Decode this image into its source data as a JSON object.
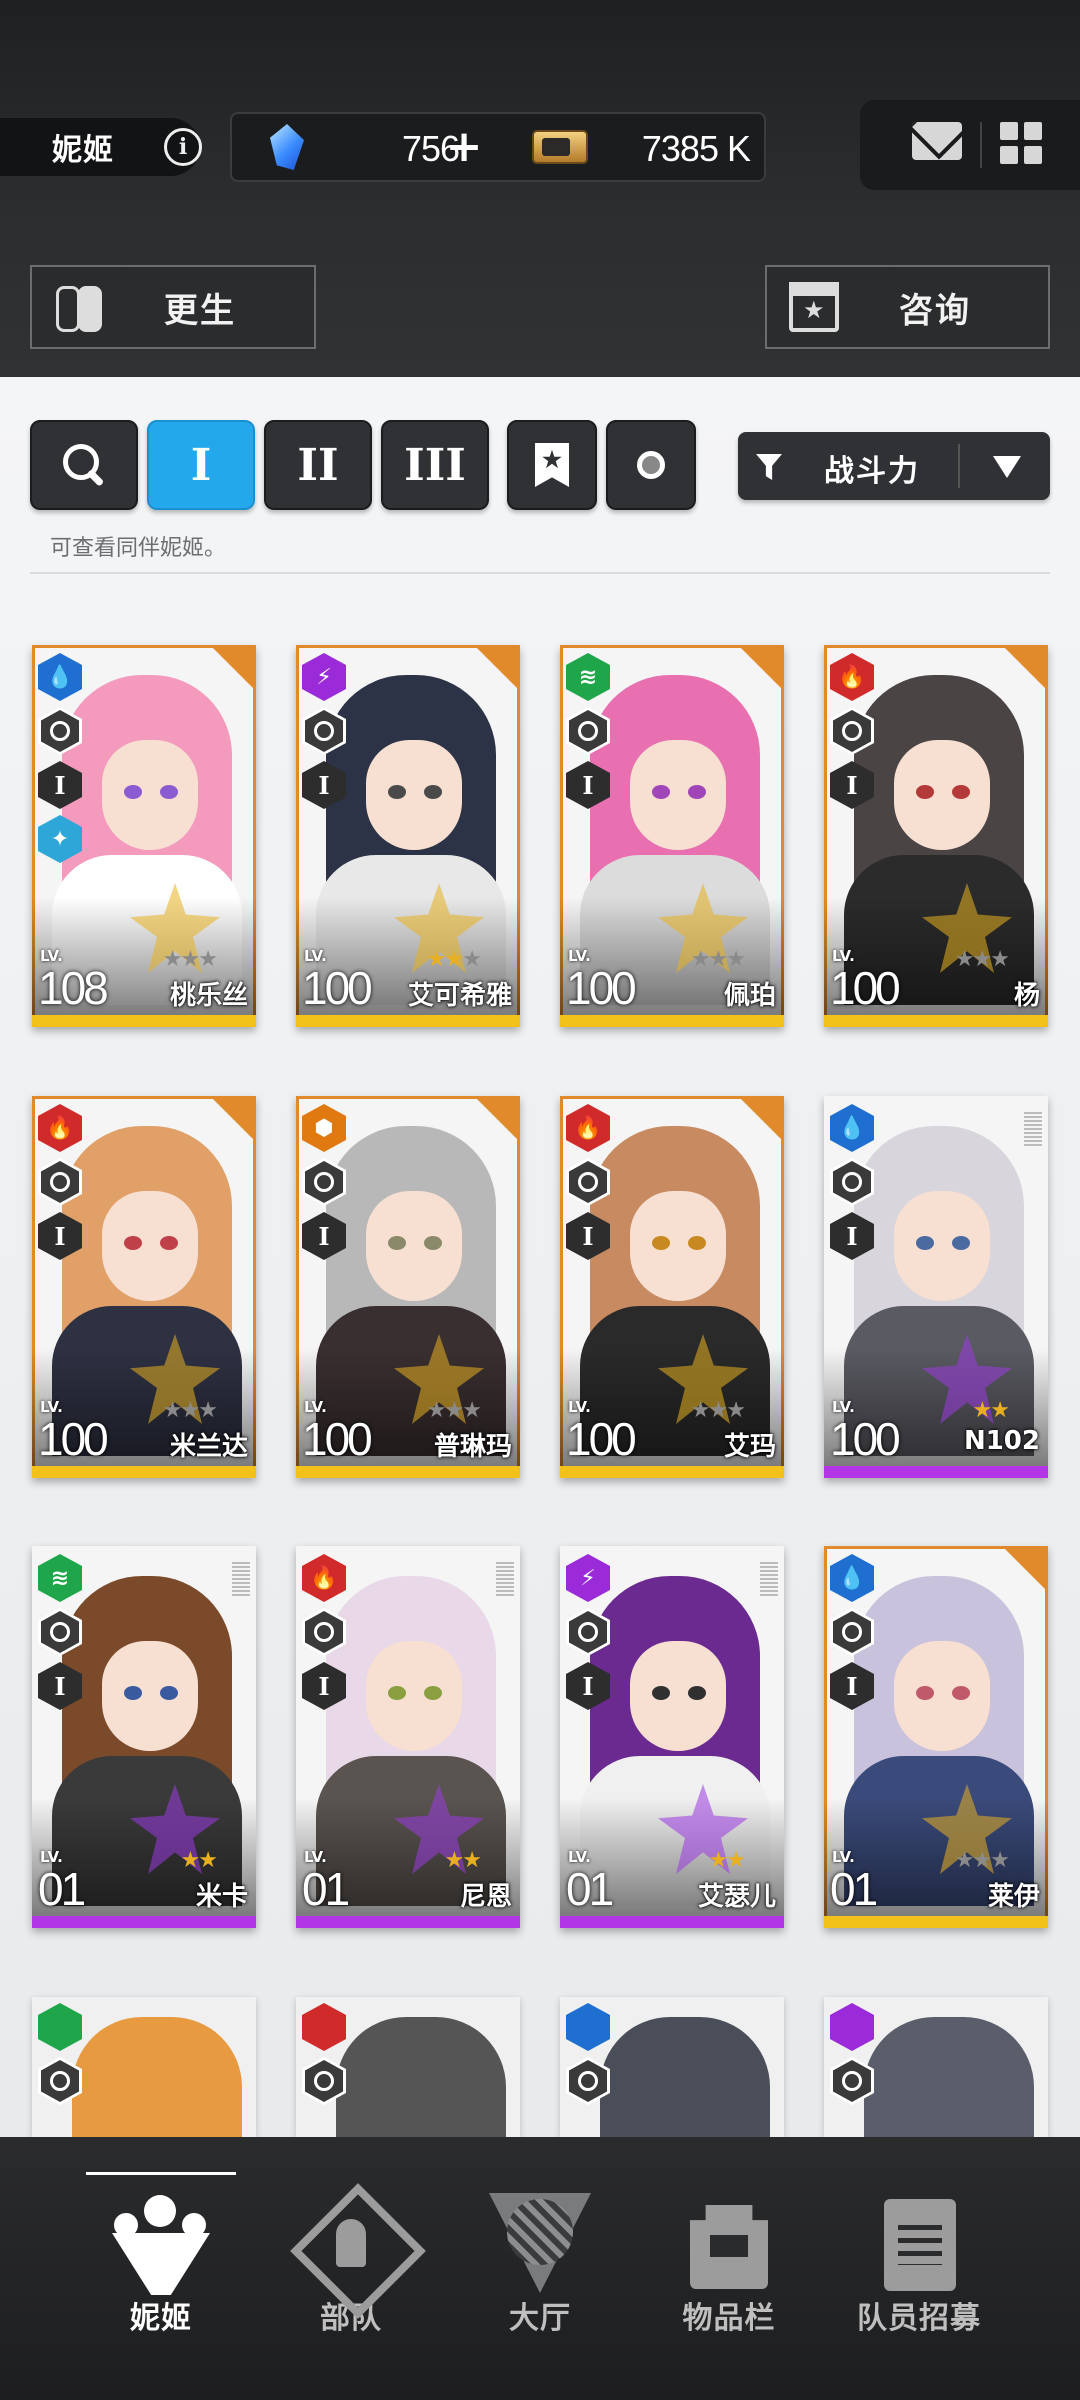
{
  "header": {
    "title": "妮姬",
    "info_icon": "info-icon",
    "gems": "756",
    "gems_plus": "+",
    "credits": "7385 K",
    "mail_icon": "mail-icon",
    "grid_icon": "grid-menu-icon"
  },
  "actions": {
    "rebirth_label": "更生",
    "consult_label": "咨询"
  },
  "filters": {
    "tiers": [
      "I",
      "II",
      "III"
    ],
    "active_tier": "I",
    "sort_label": "战斗力",
    "hint": "可查看同伴妮姬。"
  },
  "characters": [
    {
      "name": "桃乐丝",
      "lv_label": "LV.",
      "level": "108",
      "element": "water",
      "rarity": "SSR",
      "stars_on": 0,
      "stars_total": 3,
      "colors": {
        "hair": "#f49bbd",
        "body": "#ffffff",
        "eye": "#8a5bd1"
      }
    },
    {
      "name": "艾可希雅",
      "lv_label": "LV.",
      "level": "100",
      "element": "electric",
      "rarity": "SSR",
      "stars_on": 2,
      "stars_total": 3,
      "colors": {
        "hair": "#2c3346",
        "body": "#e8e8e8",
        "eye": "#4a4a4a"
      }
    },
    {
      "name": "佩珀",
      "lv_label": "LV.",
      "level": "100",
      "element": "wind",
      "rarity": "SSR",
      "stars_on": 0,
      "stars_total": 3,
      "colors": {
        "hair": "#e86fb0",
        "body": "#dcdcdc",
        "eye": "#a146b8"
      }
    },
    {
      "name": "杨",
      "lv_label": "LV.",
      "level": "100",
      "element": "fire",
      "rarity": "SSR",
      "stars_on": 0,
      "stars_total": 3,
      "colors": {
        "hair": "#4a4444",
        "body": "#2b2b2b",
        "eye": "#b43a3a"
      }
    },
    {
      "name": "米兰达",
      "lv_label": "LV.",
      "level": "100",
      "element": "fire",
      "rarity": "SSR",
      "stars_on": 0,
      "stars_total": 3,
      "colors": {
        "hair": "#e0a068",
        "body": "#2e3142",
        "eye": "#c0404a"
      }
    },
    {
      "name": "普琳玛",
      "lv_label": "LV.",
      "level": "100",
      "element": "iron",
      "rarity": "SSR",
      "stars_on": 0,
      "stars_total": 3,
      "colors": {
        "hair": "#b8b8b8",
        "body": "#3a2f30",
        "eye": "#8a8a6a"
      }
    },
    {
      "name": "艾玛",
      "lv_label": "LV.",
      "level": "100",
      "element": "fire",
      "rarity": "SSR",
      "stars_on": 0,
      "stars_total": 3,
      "colors": {
        "hair": "#c88a60",
        "body": "#2a2a2a",
        "eye": "#c88a20"
      }
    },
    {
      "name": "N102",
      "lv_label": "LV.",
      "level": "100",
      "element": "water",
      "rarity": "SR",
      "stars_on": 2,
      "stars_total": 2,
      "colors": {
        "hair": "#d8d6dc",
        "body": "#5a5a62",
        "eye": "#4a6aa0"
      }
    },
    {
      "name": "米卡",
      "lv_label": "LV.",
      "level": "01",
      "element": "wind",
      "rarity": "SR",
      "stars_on": 2,
      "stars_total": 2,
      "colors": {
        "hair": "#7a4a2a",
        "body": "#3a3a3a",
        "eye": "#3a5aa0"
      }
    },
    {
      "name": "尼恩",
      "lv_label": "LV.",
      "level": "01",
      "element": "fire",
      "rarity": "SR",
      "stars_on": 2,
      "stars_total": 2,
      "colors": {
        "hair": "#e8d8e8",
        "body": "#5a5450",
        "eye": "#8aa040"
      }
    },
    {
      "name": "艾瑟儿",
      "lv_label": "LV.",
      "level": "01",
      "element": "electric",
      "rarity": "SR",
      "stars_on": 2,
      "stars_total": 2,
      "colors": {
        "hair": "#6a2a90",
        "body": "#f0f0f0",
        "eye": "#303030"
      }
    },
    {
      "name": "莱伊",
      "lv_label": "LV.",
      "level": "01",
      "element": "water",
      "rarity": "SSR",
      "stars_on": 0,
      "stars_total": 3,
      "colors": {
        "hair": "#c8c2dc",
        "body": "#3a4a7a",
        "eye": "#c05a6a"
      }
    }
  ],
  "partial_row": [
    {
      "element": "wind",
      "color": "#e89a40"
    },
    {
      "element": "fire",
      "color": "#555555"
    },
    {
      "element": "water",
      "color": "#4a4e58"
    },
    {
      "element": "electric",
      "color": "#5a5e6a"
    }
  ],
  "nav": [
    {
      "label": "妮姬",
      "icon": "people-icon",
      "active": true
    },
    {
      "label": "部队",
      "icon": "squad-icon",
      "active": false
    },
    {
      "label": "大厅",
      "icon": "lobby-icon",
      "active": false
    },
    {
      "label": "物品栏",
      "icon": "inventory-icon",
      "active": false
    },
    {
      "label": "队员招募",
      "icon": "recruit-icon",
      "active": false
    }
  ]
}
